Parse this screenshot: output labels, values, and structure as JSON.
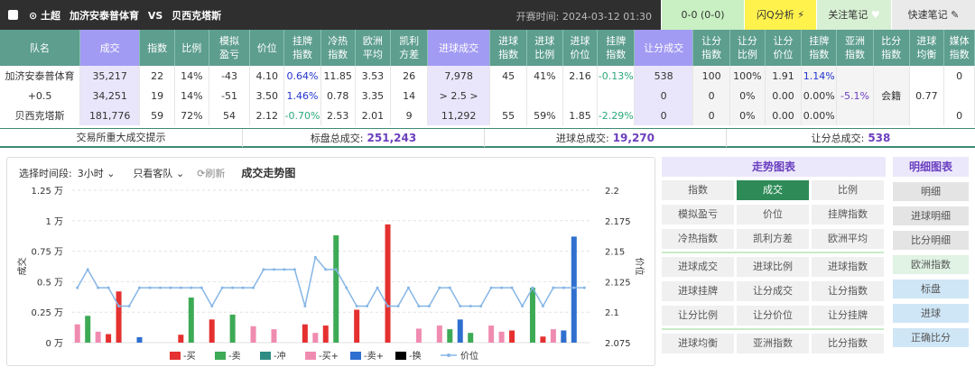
{
  "header": {
    "league": "土超",
    "home": "加济安泰普体育",
    "vs": "VS",
    "away": "贝西克塔斯",
    "kickoff": "开赛时间: 2024-03-12 01:30",
    "score": "0-0 (0-0)",
    "flash": "闪Q分析",
    "follow": "关注笔记",
    "quick": "快速笔记"
  },
  "table": {
    "headers": [
      "队名",
      "成交",
      "指数",
      "比例",
      "模拟\n盈亏",
      "价位",
      "挂牌\n指数",
      "冷热\n指数",
      "欧洲\n平均",
      "凯利\n方差",
      "进球成交",
      "进球\n指数",
      "进球\n比例",
      "进球\n价位",
      "挂牌\n指数",
      "让分成交",
      "让分\n指数",
      "让分\n比例",
      "让分\n价位",
      "挂牌\n指数",
      "亚洲\n指数",
      "比分\n指数",
      "进球\n均衡",
      "媒体\n指数"
    ],
    "rows": [
      [
        "加济安泰普体育",
        "35,217",
        "22",
        "14%",
        "-43",
        "4.10",
        "0.64%",
        "11.85",
        "3.53",
        "26",
        "7,978",
        "45",
        "41%",
        "2.16",
        "-0.13%",
        "538",
        "100",
        "100%",
        "1.91",
        "1.14%",
        "",
        "",
        "",
        "0"
      ],
      [
        "+0.5",
        "34,251",
        "19",
        "14%",
        "-51",
        "3.50",
        "1.46%",
        "0.78",
        "3.35",
        "14",
        "> 2.5 >",
        "",
        "",
        "",
        "",
        "0",
        "0",
        "0%",
        "0.00",
        "0.00%",
        "-5.1%",
        "会籍",
        "0.77",
        ""
      ],
      [
        "贝西克塔斯",
        "181,776",
        "59",
        "72%",
        "54",
        "2.12",
        "-0.70%",
        "2.53",
        "2.01",
        "9",
        "11,292",
        "55",
        "59%",
        "1.85",
        "-2.29%",
        "0",
        "0",
        "0%",
        "0.00",
        "0.00%",
        "",
        "",
        "",
        "0"
      ]
    ]
  },
  "summary": {
    "hint": "交易所重大成交提示",
    "total_label": "标盘总成交:",
    "total_value": "251,243",
    "goal_label": "进球总成交:",
    "goal_value": "19,270",
    "hcp_label": "让分总成交:",
    "hcp_value": "538"
  },
  "controls": {
    "period_label": "选择时间段:",
    "period_value": "3小时",
    "team_value": "只看客队",
    "refresh": "刷新",
    "chart_title": "成交走势图"
  },
  "chart_data": {
    "type": "bar",
    "ylabel": "成交",
    "y2label": "价位",
    "ylim": [
      0,
      12500
    ],
    "y2lim": [
      2.075,
      2.2
    ],
    "yticks": [
      "0 万",
      "0.25 万",
      "0.5 万",
      "0.75 万",
      "1 万",
      "1.25 万"
    ],
    "y2ticks": [
      "2.075",
      "2.1",
      "2.125",
      "2.15",
      "2.175",
      "2.2"
    ],
    "n": 50,
    "series": [
      {
        "name": "-买",
        "color": "#e53030",
        "points": [
          [
            3,
            700
          ],
          [
            4,
            4200
          ],
          [
            10,
            650
          ],
          [
            13,
            1900
          ],
          [
            22,
            1500
          ],
          [
            24,
            1400
          ],
          [
            27,
            2700
          ],
          [
            30,
            9700
          ],
          [
            45,
            500
          ],
          [
            42,
            1000
          ],
          [
            47,
            400
          ]
        ]
      },
      {
        "name": "-卖",
        "color": "#3daa55",
        "points": [
          [
            1,
            2200
          ],
          [
            11,
            3700
          ],
          [
            15,
            2300
          ],
          [
            25,
            8800
          ],
          [
            36,
            1100
          ],
          [
            38,
            800
          ],
          [
            44,
            4500
          ]
        ]
      },
      {
        "name": "-冲",
        "color": "#2f8c84",
        "points": []
      },
      {
        "name": "-买+",
        "color": "#f08bb0",
        "points": [
          [
            0,
            1500
          ],
          [
            2,
            900
          ],
          [
            17,
            1350
          ],
          [
            19,
            1100
          ],
          [
            23,
            800
          ],
          [
            33,
            1150
          ],
          [
            35,
            1400
          ],
          [
            40,
            1400
          ],
          [
            41,
            900
          ],
          [
            46,
            1100
          ]
        ]
      },
      {
        "name": "-卖+",
        "color": "#2f6fd0",
        "points": [
          [
            6,
            450
          ],
          [
            37,
            1900
          ],
          [
            47,
            1000
          ],
          [
            48,
            8700
          ]
        ]
      },
      {
        "name": "-换",
        "color": "#000000",
        "points": []
      }
    ],
    "price": {
      "name": "价位",
      "color": "#86b6e6",
      "values": [
        2.12,
        2.135,
        2.12,
        2.12,
        2.105,
        2.105,
        2.12,
        2.12,
        2.12,
        2.12,
        2.12,
        2.12,
        2.12,
        2.105,
        2.12,
        2.12,
        2.12,
        2.12,
        2.135,
        2.135,
        2.135,
        2.135,
        2.105,
        2.145,
        2.135,
        2.135,
        2.12,
        2.105,
        2.105,
        2.12,
        2.105,
        2.105,
        2.12,
        2.105,
        2.105,
        2.12,
        2.12,
        2.105,
        2.105,
        2.105,
        2.12,
        2.12,
        2.12,
        2.105,
        2.12,
        2.105,
        2.12,
        2.12,
        2.12,
        2.12
      ]
    }
  },
  "menu_trend": {
    "title": "走势图表",
    "items": [
      "指数",
      "成交",
      "比例",
      "模拟盈亏",
      "价位",
      "挂牌指数",
      "冷热指数",
      "凯利方差",
      "欧洲平均",
      "进球成交",
      "进球比例",
      "进球指数",
      "进球挂牌",
      "让分成交",
      "让分指数",
      "让分比例",
      "让分价位",
      "让分挂牌",
      "进球均衡",
      "亚洲指数",
      "比分指数"
    ],
    "active": "成交"
  },
  "menu_detail": {
    "title": "明细图表",
    "items": [
      "明细",
      "进球明细",
      "比分明细",
      "欧洲指数",
      "标盘",
      "进球",
      "正确比分"
    ]
  }
}
